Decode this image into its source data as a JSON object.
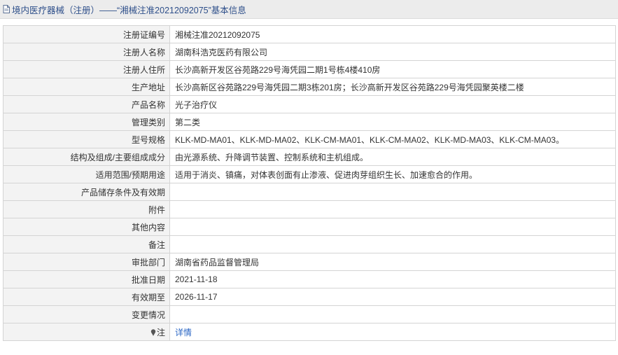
{
  "header": {
    "title": "境内医疗器械（注册）——“湘械注准20212092075”基本信息",
    "icon": "document-icon"
  },
  "rows": [
    {
      "label": "注册证编号",
      "value": "湘械注准20212092075"
    },
    {
      "label": "注册人名称",
      "value": "湖南科浩克医药有限公司"
    },
    {
      "label": "注册人住所",
      "value": "长沙高新开发区谷苑路229号海凭园二期1号栋4楼410房"
    },
    {
      "label": "生产地址",
      "value": "长沙高新区谷苑路229号海凭园二期3栋201房；长沙高新开发区谷苑路229号海凭园聚英楼二楼"
    },
    {
      "label": "产品名称",
      "value": "光子治疗仪"
    },
    {
      "label": "管理类别",
      "value": "第二类"
    },
    {
      "label": "型号规格",
      "value": "KLK-MD-MA01、KLK-MD-MA02、KLK-CM-MA01、KLK-CM-MA02、KLK-MD-MA03、KLK-CM-MA03。"
    },
    {
      "label": "结构及组成/主要组成成分",
      "value": "由光源系统、升降调节装置、控制系统和主机组成。"
    },
    {
      "label": "适用范围/预期用途",
      "value": "适用于消炎、镇痛，对体表创面有止渗液、促进肉芽组织生长、加速愈合的作用。"
    },
    {
      "label": "产品储存条件及有效期",
      "value": ""
    },
    {
      "label": "附件",
      "value": ""
    },
    {
      "label": "其他内容",
      "value": ""
    },
    {
      "label": "备注",
      "value": ""
    },
    {
      "label": "审批部门",
      "value": "湖南省药品监督管理局"
    },
    {
      "label": "批准日期",
      "value": "2021-11-18"
    },
    {
      "label": "有效期至",
      "value": "2026-11-17"
    },
    {
      "label": "变更情况",
      "value": ""
    }
  ],
  "note_row": {
    "icon": "pin-icon",
    "label": "注",
    "link_text": "详情"
  },
  "colors": {
    "title_text": "#2e4f8a",
    "title_bg": "#ececec",
    "label_bg": "#f3f3f3",
    "border": "#d4d4d4",
    "link": "#2a66c4"
  }
}
